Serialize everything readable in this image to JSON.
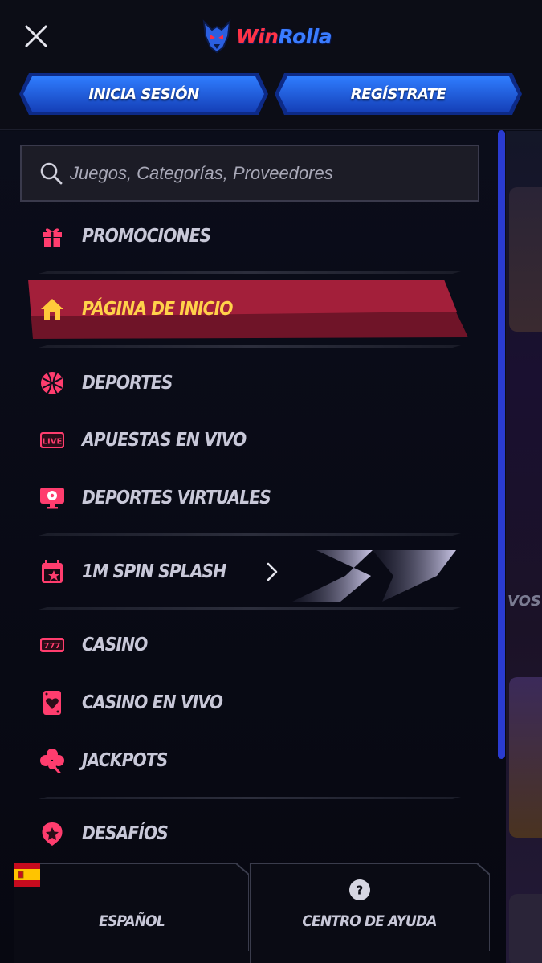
{
  "brand": {
    "logo_win": "Win",
    "logo_rolla": "Rolla"
  },
  "header": {
    "login_label": "INICIA SESIÓN",
    "register_label": "REGÍSTRATE"
  },
  "search": {
    "placeholder": "Juegos, Categorías, Proveedores",
    "value": ""
  },
  "menu": {
    "promotions": "PROMOCIONES",
    "home": "PÁGINA DE INICIO",
    "sports": "DEPORTES",
    "live_betting": "APUESTAS EN VIVO",
    "live_badge": "LIVE",
    "virtual_sports": "DEPORTES VIRTUALES",
    "spin_splash": "1M SPIN SPLASH",
    "casino": "CASINO",
    "casino_slot_digits": "777",
    "live_casino": "CASINO EN VIVO",
    "jackpots": "JACKPOTS",
    "challenges": "DESAFÍOS"
  },
  "footer": {
    "language_label": "ESPAÑOL",
    "help_label": "CENTRO DE AYUDA"
  },
  "background": {
    "peek_text": "VOS"
  },
  "icons": {
    "close": "close-icon",
    "search": "search-icon",
    "promotions": "gift-icon",
    "home": "home-icon",
    "sports": "basketball-icon",
    "live_betting": "live-badge-icon",
    "virtual_sports": "monitor-soccer-icon",
    "spin_splash": "calendar-star-icon",
    "casino": "slot-777-icon",
    "live_casino": "playing-card-heart-icon",
    "jackpots": "clover-icon",
    "challenges": "star-badge-icon",
    "language": "spain-flag-icon",
    "help": "question-circle-icon"
  },
  "colors": {
    "accent_pink": "#ff3d6e",
    "active_bg": "#9c1d35",
    "active_text": "#ffd24a",
    "primary_blue": "#1b55d9",
    "scrollbar": "#2a3bd0"
  }
}
